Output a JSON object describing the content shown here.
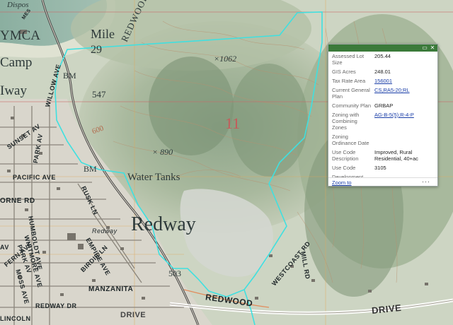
{
  "map": {
    "labels": {
      "ymca": "YMCA",
      "camp": "Camp",
      "mile": "Mile",
      "mile_no": "29",
      "redway_big": "Redway",
      "redway_partial": "Iway",
      "water_tanks": "Water Tanks",
      "bm_1": "BM",
      "bm_2": "BM",
      "elev_547": "547",
      "elev_1062": "×1062",
      "elev_890": "× 890",
      "elev_503": "503",
      "elev_600": "600",
      "section_11": "11",
      "road_redwood_v": "REDWOOD",
      "street_sunset": "SUNSET AV",
      "street_park": "PARK AV",
      "street_willow": "WILLOW AVE",
      "street_pacific": "PACIFIC AVE",
      "street_rusk": "RUSK LN",
      "street_orne": "ORNE RD",
      "street_humboldt": "HUMBOLDT AVE",
      "street_whitmore": "WHITMORE AVE",
      "street_empire": "EMPIRE AVE",
      "street_birdie": "BIRDIE LN",
      "street_manzanita": "MANZANITA",
      "street_redway_dr": "REDWAY DR",
      "street_redway": "Redway",
      "street_westcoast": "WESTCOAST RD",
      "street_mill": "MILL RD",
      "street_drive_left": "DRIVE",
      "street_drive_right": "DRIVE",
      "street_redwood_bottom": "REDWOOD",
      "street_fern": "FERN AVE",
      "street_moss": "MOSS AVE",
      "street_park2": "PARK AV",
      "street_av": "AV",
      "street_lincoln": "LINCOLN",
      "street_dispos": "Dispos",
      "street_mes": "MES"
    }
  },
  "popup": {
    "rows": [
      {
        "label": "Assessed Lot Size",
        "value": "205.44",
        "link": false
      },
      {
        "label": "GIS Acres",
        "value": "248.01",
        "link": false
      },
      {
        "label": "Tax Rate Area",
        "value": "156001",
        "link": true
      },
      {
        "label": "Current General Plan",
        "value": "CS,RA5-20;RL",
        "link": true
      },
      {
        "label": "Community Plan",
        "value": "GRBAP",
        "link": false
      },
      {
        "label": "Zoning with Combining Zones",
        "value": "AG-B-5(5);R-4-P",
        "link": true
      },
      {
        "label": "Zoning Ordinance Date",
        "value": "",
        "link": false
      },
      {
        "label": "Use Code Description",
        "value": "Improved, Rural Residential, 40+ac",
        "link": false
      },
      {
        "label": "Use Code",
        "value": "3105",
        "link": false
      },
      {
        "label": "Development Plan on file(Y/N)",
        "value": "",
        "link": false
      }
    ],
    "zoom_to": "Zoom to",
    "more": "···",
    "maximize_icon": "▭",
    "close_icon": "✕"
  },
  "colors": {
    "parcel_outline": "#3fe0e0",
    "popup_header": "#3b7a3a",
    "link": "#1a3ea8"
  }
}
